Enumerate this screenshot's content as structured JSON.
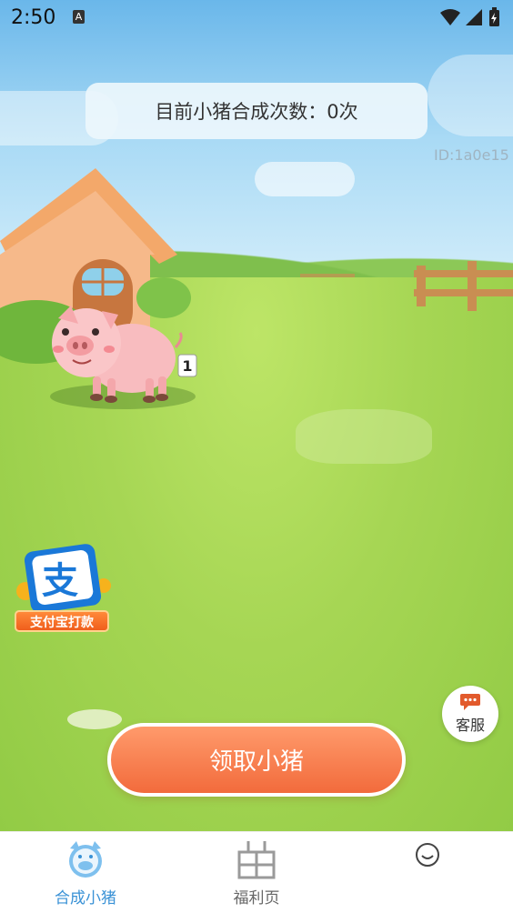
{
  "status_bar": {
    "time": "2:50",
    "notification_letter": "A"
  },
  "counter": {
    "text": "目前小猪合成次数：0次"
  },
  "device_id": "ID:1a0e15",
  "pig": {
    "level": "1"
  },
  "alipay_badge": {
    "glyph": "支",
    "label": "支付宝打款"
  },
  "customer_service": {
    "label": "客服"
  },
  "claim_button": {
    "label": "领取小猪"
  },
  "bottom_nav": [
    {
      "label": "合成小猪",
      "icon": "pig-face-icon",
      "active": true
    },
    {
      "label": "福利页",
      "icon": "grid-tree-icon",
      "active": false
    },
    {
      "label": "",
      "icon": "smiley-icon",
      "active": false
    }
  ],
  "colors": {
    "accent": "#f26b3c",
    "nav_active": "#3a92d6",
    "nav_inactive": "#666666"
  }
}
